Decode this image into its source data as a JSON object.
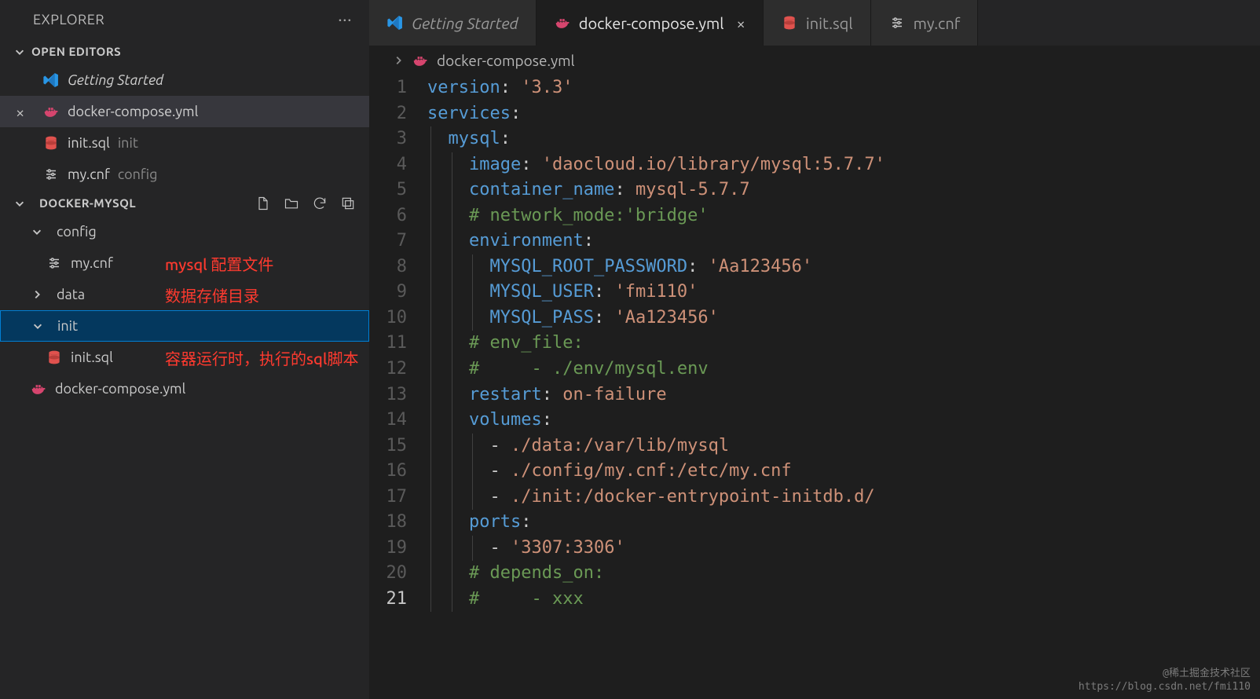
{
  "sidebar": {
    "title": "EXPLORER",
    "open_editors_label": "OPEN EDITORS",
    "open_editors": [
      {
        "label": "Getting Started",
        "icon": "vscode",
        "italic": true
      },
      {
        "label": "docker-compose.yml",
        "icon": "docker",
        "active": true
      },
      {
        "label": "init.sql",
        "detail": "init",
        "icon": "db"
      },
      {
        "label": "my.cnf",
        "detail": "config",
        "icon": "settings"
      }
    ],
    "project_name": "DOCKER-MYSQL",
    "tree": [
      {
        "type": "folder",
        "label": "config",
        "open": true,
        "depth": 0
      },
      {
        "type": "file",
        "label": "my.cnf",
        "icon": "settings",
        "depth": 1,
        "annot": "mysql 配置文件"
      },
      {
        "type": "folder",
        "label": "data",
        "open": false,
        "depth": 0,
        "annot": "数据存储目录"
      },
      {
        "type": "folder",
        "label": "init",
        "open": true,
        "depth": 0,
        "selected": true
      },
      {
        "type": "file",
        "label": "init.sql",
        "icon": "db",
        "depth": 1,
        "annot": "容器运行时，执行的sql脚本"
      },
      {
        "type": "file",
        "label": "docker-compose.yml",
        "icon": "docker",
        "depth": 0
      }
    ]
  },
  "tabs": [
    {
      "label": "Getting Started",
      "icon": "vscode",
      "italic": true
    },
    {
      "label": "docker-compose.yml",
      "icon": "docker",
      "active": true,
      "closable": true
    },
    {
      "label": "init.sql",
      "icon": "db"
    },
    {
      "label": "my.cnf",
      "icon": "settings"
    }
  ],
  "crumb": {
    "icon": "docker",
    "label": "docker-compose.yml"
  },
  "editor": {
    "line_count": 21,
    "active_line": 21,
    "lines": [
      [
        [
          "key",
          "version"
        ],
        [
          "punc",
          ": "
        ],
        [
          "str",
          "'3.3'"
        ]
      ],
      [
        [
          "key",
          "services"
        ],
        [
          "punc",
          ":"
        ]
      ],
      [
        [
          "sp",
          "  "
        ],
        [
          "key",
          "mysql"
        ],
        [
          "punc",
          ":"
        ]
      ],
      [
        [
          "sp",
          "    "
        ],
        [
          "key",
          "image"
        ],
        [
          "punc",
          ": "
        ],
        [
          "str",
          "'daocloud.io/library/mysql:5.7.7'"
        ]
      ],
      [
        [
          "sp",
          "    "
        ],
        [
          "key",
          "container_name"
        ],
        [
          "punc",
          ": "
        ],
        [
          "val",
          "mysql-5.7.7"
        ]
      ],
      [
        [
          "sp",
          "    "
        ],
        [
          "cmt",
          "# network_mode:'bridge'"
        ]
      ],
      [
        [
          "sp",
          "    "
        ],
        [
          "key",
          "environment"
        ],
        [
          "punc",
          ":"
        ]
      ],
      [
        [
          "sp",
          "      "
        ],
        [
          "key",
          "MYSQL_ROOT_PASSWORD"
        ],
        [
          "punc",
          ": "
        ],
        [
          "str",
          "'Aa123456'"
        ]
      ],
      [
        [
          "sp",
          "      "
        ],
        [
          "key",
          "MYSQL_USER"
        ],
        [
          "punc",
          ": "
        ],
        [
          "str",
          "'fmi110'"
        ]
      ],
      [
        [
          "sp",
          "      "
        ],
        [
          "key",
          "MYSQL_PASS"
        ],
        [
          "punc",
          ": "
        ],
        [
          "str",
          "'Aa123456'"
        ]
      ],
      [
        [
          "sp",
          "    "
        ],
        [
          "cmt",
          "# env_file:"
        ]
      ],
      [
        [
          "sp",
          "    "
        ],
        [
          "cmt",
          "#     - ./env/mysql.env"
        ]
      ],
      [
        [
          "sp",
          "    "
        ],
        [
          "key",
          "restart"
        ],
        [
          "punc",
          ": "
        ],
        [
          "val",
          "on-failure"
        ]
      ],
      [
        [
          "sp",
          "    "
        ],
        [
          "key",
          "volumes"
        ],
        [
          "punc",
          ":"
        ]
      ],
      [
        [
          "sp",
          "      "
        ],
        [
          "punc",
          "- "
        ],
        [
          "val",
          "./data:/var/lib/mysql"
        ]
      ],
      [
        [
          "sp",
          "      "
        ],
        [
          "punc",
          "- "
        ],
        [
          "val",
          "./config/my.cnf:/etc/my.cnf"
        ]
      ],
      [
        [
          "sp",
          "      "
        ],
        [
          "punc",
          "- "
        ],
        [
          "val",
          "./init:/docker-entrypoint-initdb.d/"
        ]
      ],
      [
        [
          "sp",
          "    "
        ],
        [
          "key",
          "ports"
        ],
        [
          "punc",
          ":"
        ]
      ],
      [
        [
          "sp",
          "      "
        ],
        [
          "punc",
          "- "
        ],
        [
          "str",
          "'3307:3306'"
        ]
      ],
      [
        [
          "sp",
          "    "
        ],
        [
          "cmt",
          "# depends_on:"
        ]
      ],
      [
        [
          "sp",
          "    "
        ],
        [
          "cmt",
          "#     - xxx"
        ]
      ]
    ]
  },
  "watermark": {
    "top": "@稀土掘金技术社区",
    "bottom": "https://blog.csdn.net/fmi110"
  }
}
